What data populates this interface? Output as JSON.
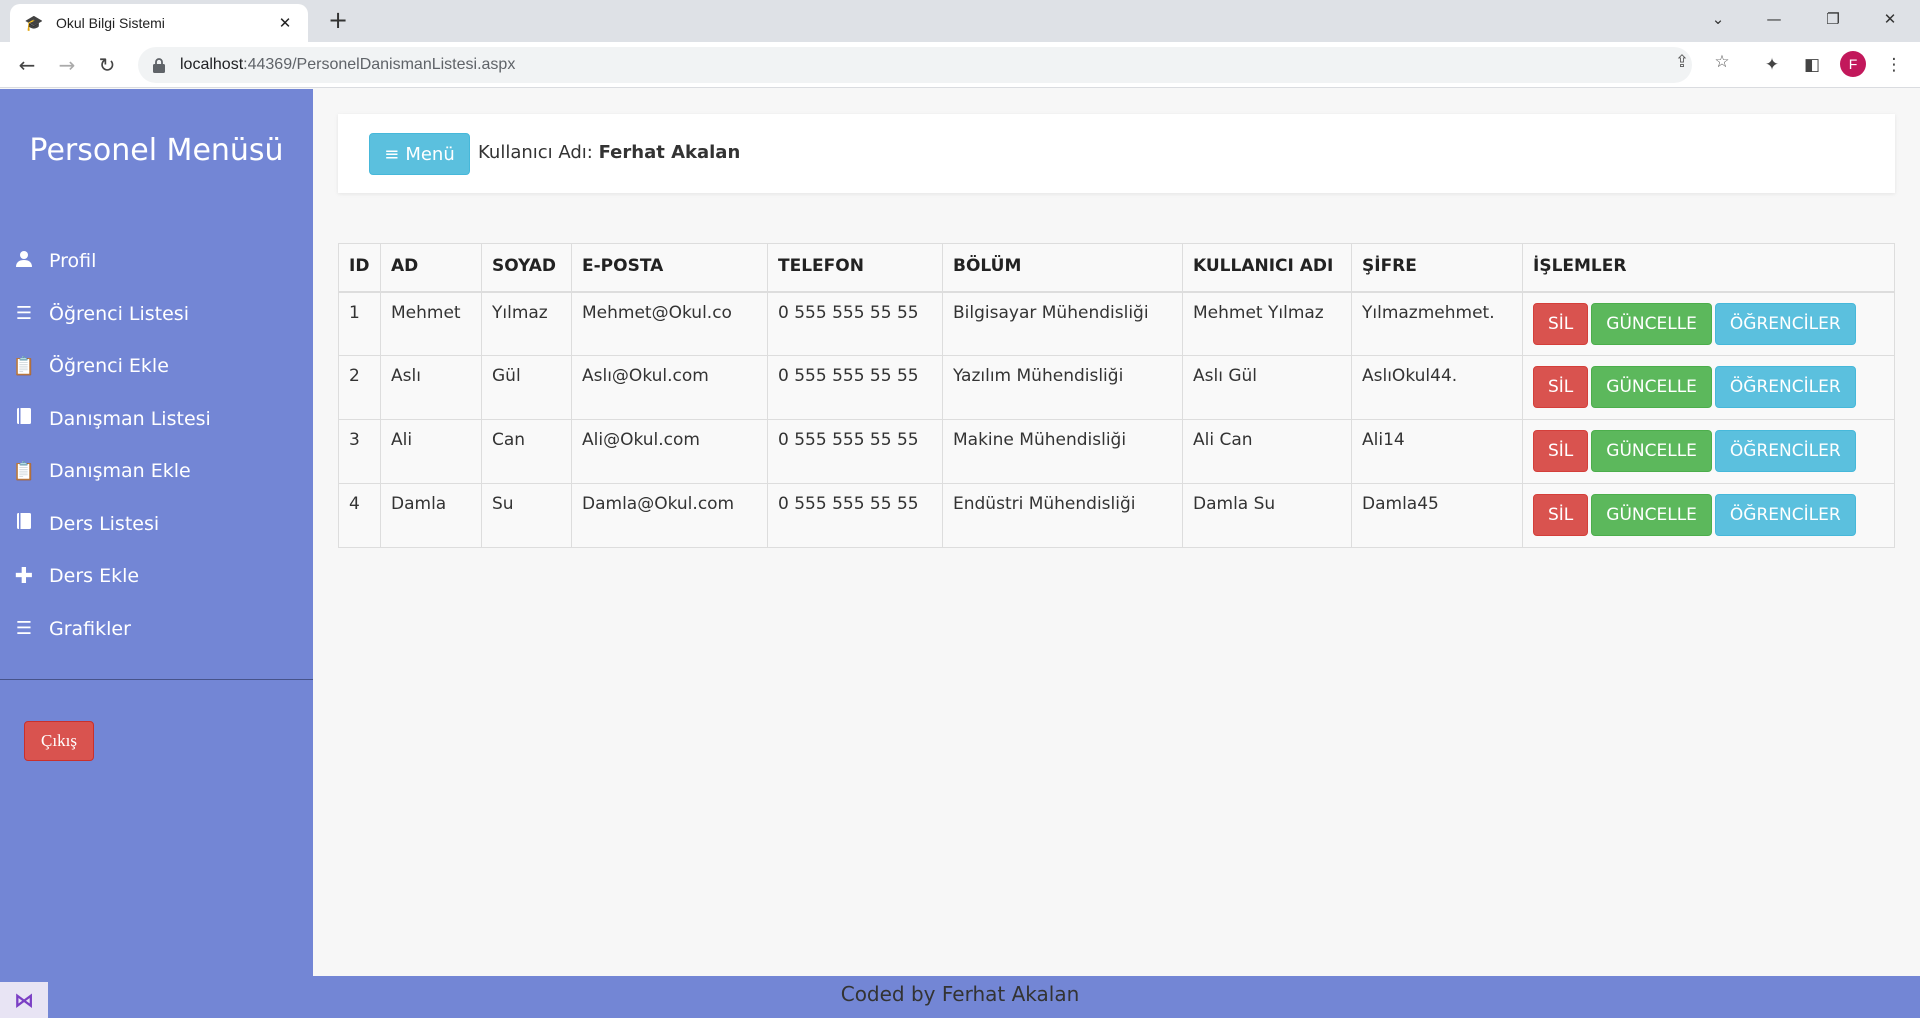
{
  "browser": {
    "tab_title": "Okul Bilgi Sistemi",
    "url_host": "localhost",
    "url_rest": ":44369/PersonelDanismanListesi.aspx",
    "profile_initial": "F"
  },
  "sidebar": {
    "title": "Personel Menüsü",
    "items": [
      {
        "label": "Profil",
        "icon": "user-icon"
      },
      {
        "label": "Öğrenci Listesi",
        "icon": "list-icon"
      },
      {
        "label": "Öğrenci Ekle",
        "icon": "clipboard-icon"
      },
      {
        "label": "Danışman Listesi",
        "icon": "book-icon"
      },
      {
        "label": "Danışman Ekle",
        "icon": "clipboard-icon"
      },
      {
        "label": "Ders Listesi",
        "icon": "book-icon"
      },
      {
        "label": "Ders Ekle",
        "icon": "plus-icon"
      },
      {
        "label": "Grafikler",
        "icon": "list-icon"
      }
    ],
    "exit_label": "Çıkış"
  },
  "header": {
    "menu_label": "Menü",
    "user_prefix": "Kullanıcı Adı:",
    "user_name": "Ferhat Akalan"
  },
  "table": {
    "columns": [
      "ID",
      "AD",
      "SOYAD",
      "E-POSTA",
      "TELEFON",
      "BÖLÜM",
      "KULLANICI ADI",
      "ŞİFRE",
      "İŞLEMLER"
    ],
    "rows": [
      [
        "1",
        "Mehmet",
        "Yılmaz",
        "Mehmet@Okul.co",
        "0 555 555 55 55",
        "Bilgisayar Mühendisliği",
        "Mehmet Yılmaz",
        "Yılmazmehmet."
      ],
      [
        "2",
        "Aslı",
        "Gül",
        "Aslı@Okul.com",
        "0 555 555 55 55",
        "Yazılım Mühendisliği",
        "Aslı Gül",
        "AslıOkul44."
      ],
      [
        "3",
        "Ali",
        "Can",
        "Ali@Okul.com",
        "0 555 555 55 55",
        "Makine Mühendisliği",
        "Ali Can",
        "Ali14"
      ],
      [
        "4",
        "Damla",
        "Su",
        "Damla@Okul.com",
        "0 555 555 55 55",
        "Endüstri Mühendisliği",
        "Damla Su",
        "Damla45"
      ]
    ],
    "actions": {
      "delete": "SİL",
      "update": "GÜNCELLE",
      "students": "ÖĞRENCİLER"
    }
  },
  "footer": {
    "text": "Coded by Ferhat Akalan"
  },
  "colors": {
    "sidebar": "#7386d5",
    "danger": "#d9534f",
    "success": "#5cb85c",
    "info": "#5bc0de"
  }
}
